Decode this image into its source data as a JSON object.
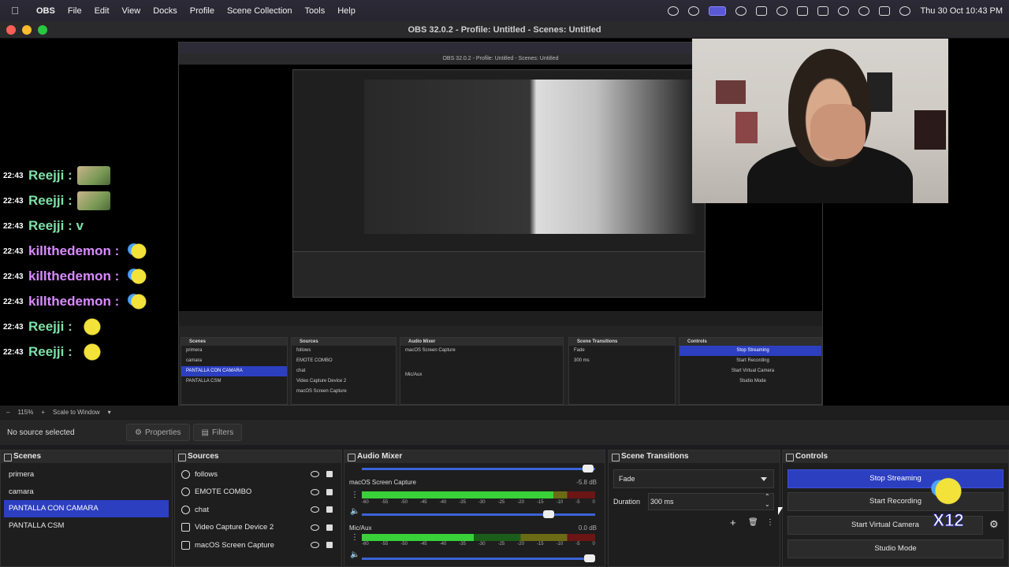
{
  "menubar": {
    "app": "OBS",
    "items": [
      "File",
      "Edit",
      "View",
      "Docks",
      "Profile",
      "Scene Collection",
      "Tools",
      "Help"
    ],
    "clock": "Thu 30 Oct  10:43 PM"
  },
  "window": {
    "title": "OBS 32.0.2 - Profile: Untitled - Scenes: Untitled"
  },
  "preview": {
    "chat": [
      {
        "time": "22:43",
        "user": "Reejji :",
        "color": "#7de0a6",
        "emote": "img"
      },
      {
        "time": "22:43",
        "user": "Reejji :",
        "color": "#7de0a6",
        "emote": "img"
      },
      {
        "time": "22:43",
        "user": "Reejji : v",
        "color": "#7de0a6",
        "emote": "none"
      },
      {
        "time": "22:43",
        "user": "killthedemon :",
        "color": "#d98bff",
        "emote": "face"
      },
      {
        "time": "22:43",
        "user": "killthedemon :",
        "color": "#d98bff",
        "emote": "face"
      },
      {
        "time": "22:43",
        "user": "killthedemon :",
        "color": "#d98bff",
        "emote": "face"
      },
      {
        "time": "22:43",
        "user": "Reejji :",
        "color": "#7de0a6",
        "emote": "face2"
      },
      {
        "time": "22:43",
        "user": "Reejji :",
        "color": "#7de0a6",
        "emote": "face2"
      }
    ],
    "nested_title": "OBS 32.0.2 - Profile: Untitled - Scenes: Untitled"
  },
  "zoom": {
    "value": "115%",
    "mode": "Scale to Window"
  },
  "toolbar": {
    "no_source": "No source selected",
    "properties": "Properties",
    "filters": "Filters"
  },
  "scenes": {
    "title": "Scenes",
    "items": [
      "primera",
      "camara",
      "PANTALLA CON CAMARA",
      "PANTALLA CSM"
    ],
    "selected_index": 2
  },
  "sources": {
    "title": "Sources",
    "items": [
      "follows",
      "EMOTE COMBO",
      "chat",
      "Video Capture Device 2",
      "macOS Screen Capture"
    ]
  },
  "mixer": {
    "title": "Audio Mixer",
    "channels": [
      {
        "name": "macOS Screen Capture",
        "db": "-5.8 dB",
        "level": 0.82
      },
      {
        "name": "Mic/Aux",
        "db": "0.0 dB",
        "level": 0.48
      }
    ],
    "ticks": [
      "-60",
      "-55",
      "-50",
      "-45",
      "-40",
      "-35",
      "-30",
      "-25",
      "-20",
      "-15",
      "-10",
      "-5",
      "0"
    ]
  },
  "transitions": {
    "title": "Scene Transitions",
    "type": "Fade",
    "duration_label": "Duration",
    "duration": "300 ms"
  },
  "controls": {
    "title": "Controls",
    "stop_streaming": "Stop Streaming",
    "start_recording": "Start Recording",
    "start_virtual_camera": "Start Virtual Camera",
    "studio_mode": "Studio Mode",
    "badge": "X12"
  },
  "colors": {
    "accent": "#2c3fc1",
    "reejji": "#7de0a6",
    "killthedemon": "#d98bff"
  }
}
